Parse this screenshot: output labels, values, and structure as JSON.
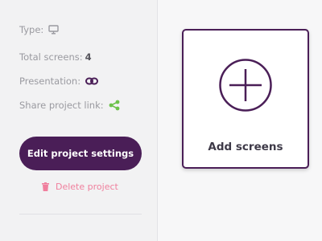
{
  "sidebar": {
    "type_label": "Type:",
    "type_icon": "monitor-icon",
    "total_label": "Total screens:",
    "total_value": "4",
    "presentation_label": "Presentation:",
    "presentation_icon": "link-icon",
    "share_label": "Share project link:",
    "share_icon": "share-icon",
    "edit_button": "Edit project settings",
    "delete_icon": "trash-icon",
    "delete_label": "Delete project"
  },
  "main": {
    "add_label": "Add screens",
    "add_icon": "plus-circle-icon"
  },
  "colors": {
    "accent": "#4a1e57",
    "share_green": "#6cc24a",
    "delete_pink": "#f07f9d",
    "muted_text": "#9a9aa0"
  }
}
